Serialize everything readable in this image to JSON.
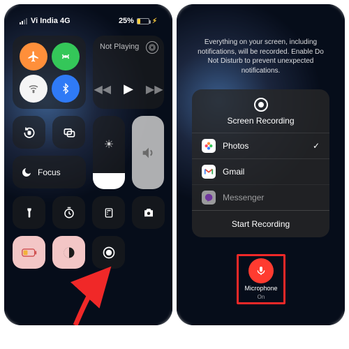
{
  "status": {
    "carrier": "Vi India 4G",
    "battery_pct": "25%"
  },
  "cc": {
    "media": {
      "not_playing": "Not Playing"
    },
    "focus_label": "Focus"
  },
  "sheet": {
    "info": "Everything on your screen, including notifications, will be recorded. Enable Do Not Disturb to prevent unexpected notifications.",
    "title": "Screen Recording",
    "options": [
      {
        "label": "Photos",
        "checked": true
      },
      {
        "label": "Gmail",
        "checked": false
      },
      {
        "label": "Messenger",
        "checked": false
      }
    ],
    "start": "Start Recording"
  },
  "mic": {
    "label": "Microphone",
    "state": "On"
  },
  "colors": {
    "accent_red": "#ff3b30"
  }
}
